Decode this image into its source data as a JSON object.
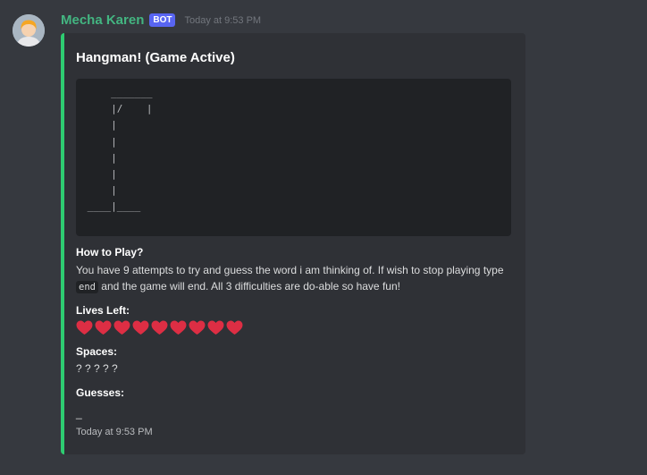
{
  "message": {
    "author": "Mecha Karen",
    "bot_tag": "BOT",
    "timestamp": "Today at 9:53 PM"
  },
  "embed": {
    "accent_color": "#2ecc71",
    "title": "Hangman! (Game Active)",
    "ascii_art": "     _______\n     |/    |\n     |\n     |\n     |\n     |\n     |\n ____|____",
    "fields": {
      "how_to_play": {
        "name": "How to Play?",
        "value_part1": "You have 9 attempts to try and guess the word i am thinking of. If wish to stop playing type ",
        "value_code": "end",
        "value_part2": " and the game will end. All 3 difficulties are do-able so have fun!"
      },
      "lives": {
        "name": "Lives Left:",
        "count": 9,
        "icon": "red-heart-icon",
        "color": "#dd2e44"
      },
      "spaces": {
        "name": "Spaces:",
        "value": "? ? ? ? ?"
      },
      "guesses": {
        "name": "Guesses:",
        "value": "_"
      }
    },
    "footer": "Today at 9:53 PM"
  }
}
